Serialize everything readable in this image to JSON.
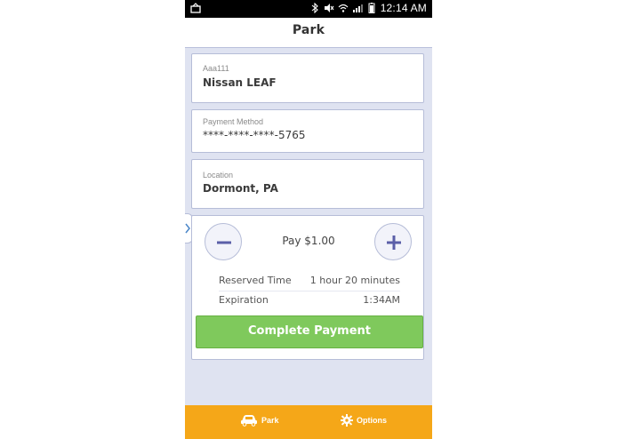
{
  "status_bar": {
    "time": "12:14 AM"
  },
  "header": {
    "title": "Park"
  },
  "vehicle": {
    "label": "Aaa111",
    "value": "Nissan LEAF"
  },
  "payment": {
    "label": "Payment Method",
    "value": "****-****-****-5765"
  },
  "location": {
    "label": "Location",
    "value": "Dormont, PA"
  },
  "pay": {
    "amount_label": "Pay $1.00",
    "reserved_time_label": "Reserved Time",
    "reserved_time_value": "1 hour 20 minutes",
    "expiration_label": "Expiration",
    "expiration_value": "1:34AM",
    "complete_button": "Complete Payment"
  },
  "bottom_nav": {
    "items": [
      {
        "label": "Park",
        "icon": "car-icon"
      },
      {
        "label": "Options",
        "icon": "gear-icon"
      }
    ]
  },
  "colors": {
    "accent": "#f5a718",
    "button_green": "#7fc95c",
    "background": "#dfe3f1",
    "round_button_icon": "#5b5fa8"
  }
}
